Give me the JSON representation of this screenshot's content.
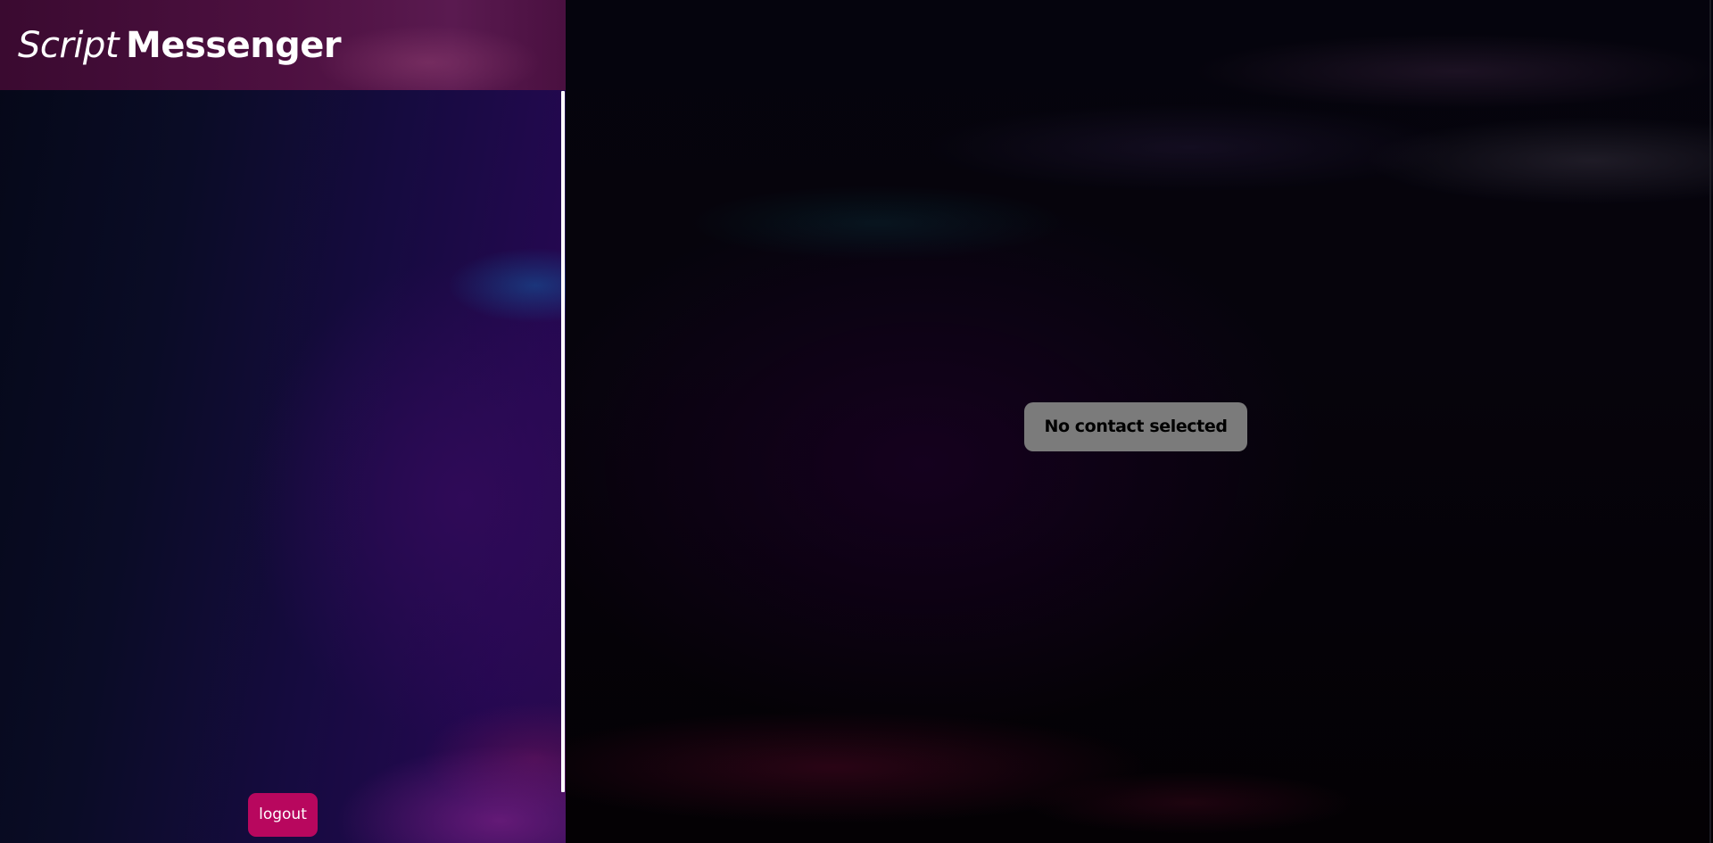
{
  "app": {
    "brand_script": "Script",
    "brand_messenger": "Messenger"
  },
  "sidebar": {
    "logout_label": "logout",
    "contacts": []
  },
  "chat": {
    "empty_state": "No contact selected"
  },
  "colors": {
    "header_bg": "#4d1040",
    "logout_bg": "#b8075e",
    "badge_bg": "#7b7b7b",
    "scrollbar": "#ffffff"
  }
}
